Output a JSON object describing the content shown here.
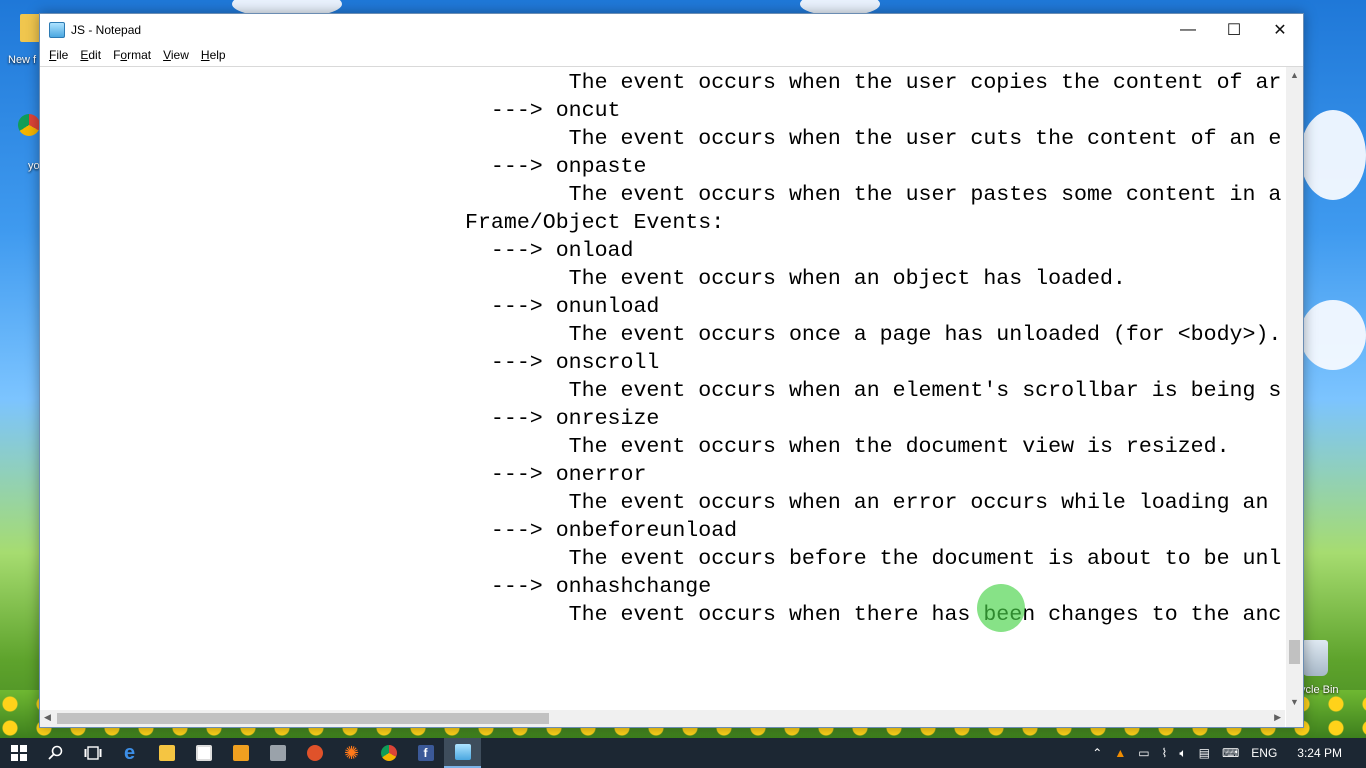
{
  "desktop": {
    "icons": [
      {
        "label": "New f",
        "name": "new-folder"
      },
      {
        "label": "yo",
        "name": "chrome"
      },
      {
        "label": "ycle Bin",
        "name": "recycle-bin"
      }
    ]
  },
  "window": {
    "title": "JS - Notepad",
    "controls": {
      "minimize": "—",
      "maximize": "☐",
      "close": "✕"
    },
    "menu": [
      {
        "label": "File",
        "accel": "F",
        "rest": "ile"
      },
      {
        "label": "Edit",
        "accel": "E",
        "rest": "dit"
      },
      {
        "label": "Format",
        "accel": "o",
        "pre": "F",
        "rest": "rmat"
      },
      {
        "label": "View",
        "accel": "V",
        "rest": "iew"
      },
      {
        "label": "Help",
        "accel": "H",
        "rest": "elp"
      }
    ]
  },
  "document": {
    "lines": [
      "        The event occurs when the user copies the content of ar",
      "  ---> oncut",
      "        The event occurs when the user cuts the content of an e",
      "  ---> onpaste",
      "        The event occurs when the user pastes some content in a",
      "Frame/Object Events:",
      "  ---> onload",
      "        The event occurs when an object has loaded.",
      "  ---> onunload",
      "        The event occurs once a page has unloaded (for <body>).",
      "  ---> onscroll",
      "        The event occurs when an element's scrollbar is being s",
      "  ---> onresize",
      "        The event occurs when the document view is resized.",
      "  ---> onerror",
      "        The event occurs when an error occurs while loading an",
      "  ---> onbeforeunload",
      "        The event occurs before the document is about to be unl",
      "  ---> onhashchange",
      "        The event occurs when there has been changes to the anc"
    ]
  },
  "scroll": {
    "vertical_position": 0.95,
    "horizontal_position": 0.0
  },
  "taskbar": {
    "icons": [
      "start-icon",
      "search-icon",
      "task-view-icon",
      "edge-icon",
      "file-explorer-icon",
      "store-icon",
      "media-player-icon",
      "film-icon",
      "fox-icon",
      "spark-icon",
      "chrome-icon",
      "facebook-icon",
      "notepad-icon"
    ],
    "language": "ENG",
    "time": "3:24 PM"
  }
}
